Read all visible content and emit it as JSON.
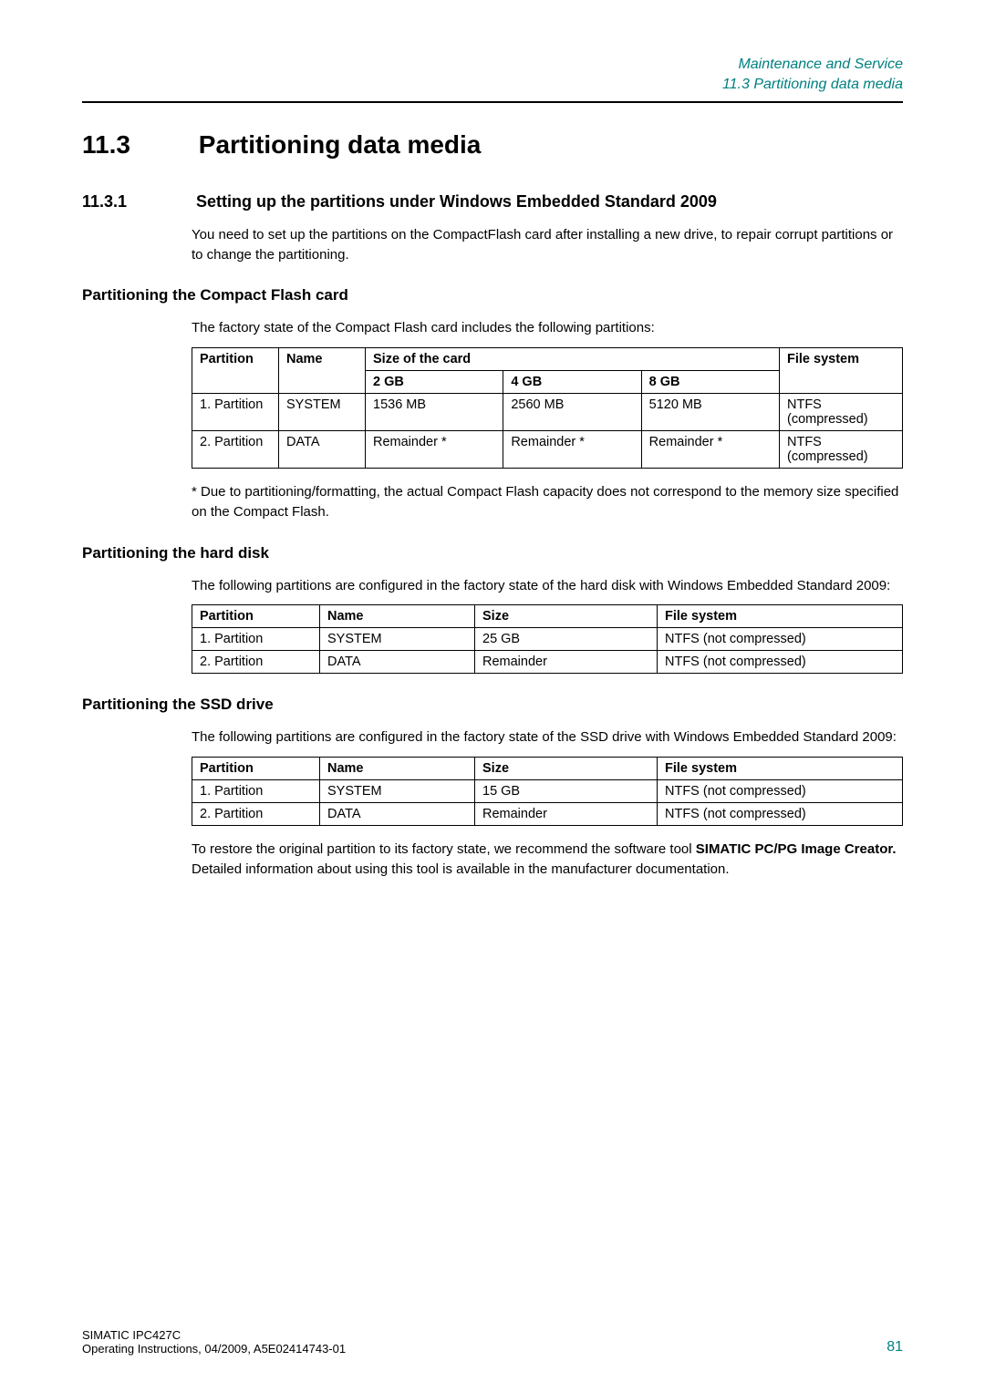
{
  "running_head": {
    "line1": "Maintenance and Service",
    "line2": "11.3 Partitioning data media"
  },
  "section": {
    "num": "11.3",
    "title": "Partitioning data media"
  },
  "sub_11_3_1": {
    "num": "11.3.1",
    "title": "Setting up the partitions under Windows Embedded Standard 2009",
    "p1": "You need to set up the partitions on the CompactFlash card after installing a new drive, to repair corrupt partitions or to change the partitioning."
  },
  "sec_cf": {
    "heading": "Partitioning the Compact Flash card",
    "intro": "The factory state of the Compact Flash card includes the following partitions:",
    "th": {
      "partition": "Partition",
      "name": "Name",
      "sizecard": "Size of the card",
      "fs": "File system",
      "s2": "2 GB",
      "s4": "4 GB",
      "s8": "8 GB"
    },
    "rows": [
      {
        "partition": "1. Partition",
        "name": "SYSTEM",
        "s2": "1536 MB",
        "s4": "2560 MB",
        "s8": "5120 MB",
        "fs": "NTFS (compressed)"
      },
      {
        "partition": "2. Partition",
        "name": "DATA",
        "s2": "Remainder *",
        "s4": "Remainder *",
        "s8": "Remainder *",
        "fs": "NTFS (compressed)"
      }
    ],
    "footnote": "* Due to partitioning/formatting, the actual Compact Flash capacity does not correspond to the memory size specified on the Compact Flash."
  },
  "sec_hd": {
    "heading": "Partitioning the hard disk",
    "intro": "The following partitions are configured in the factory state of the hard disk with Windows Embedded Standard 2009:",
    "th": {
      "partition": "Partition",
      "name": "Name",
      "size": "Size",
      "fs": "File system"
    },
    "rows": [
      {
        "partition": "1. Partition",
        "name": "SYSTEM",
        "size": "25 GB",
        "fs": "NTFS (not compressed)"
      },
      {
        "partition": "2. Partition",
        "name": "DATA",
        "size": "Remainder",
        "fs": "NTFS (not compressed)"
      }
    ]
  },
  "sec_ssd": {
    "heading": "Partitioning the SSD drive",
    "intro": "The following partitions are configured in the factory state of the SSD drive with Windows Embedded Standard 2009:",
    "th": {
      "partition": "Partition",
      "name": "Name",
      "size": "Size",
      "fs": "File system"
    },
    "rows": [
      {
        "partition": "1. Partition",
        "name": "SYSTEM",
        "size": "15 GB",
        "fs": "NTFS (not compressed)"
      },
      {
        "partition": "2. Partition",
        "name": "DATA",
        "size": "Remainder",
        "fs": "NTFS (not compressed)"
      }
    ],
    "tail": {
      "pre": "To restore the original partition to its factory state, we recommend the software tool ",
      "b1": "SIMATIC PC/PG Image Creator.",
      "post": " Detailed information about using this tool is available in the manufacturer documentation."
    }
  },
  "footer": {
    "l1": "SIMATIC IPC427C",
    "l2": "Operating Instructions, 04/2009, A5E02414743-01",
    "page": "81"
  }
}
